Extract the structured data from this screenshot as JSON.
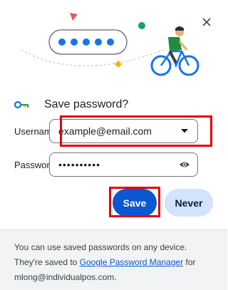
{
  "dialog": {
    "title": "Save password?",
    "close_label": "Close"
  },
  "form": {
    "username_label": "Username",
    "username_value": "example@email.com",
    "password_label": "Password",
    "password_value": "••••••••••"
  },
  "buttons": {
    "save_label": "Save",
    "never_label": "Never"
  },
  "footer": {
    "text_before_link": "You can use saved passwords on any device. They're saved to ",
    "link_text": "Google Password Manager",
    "text_after_link": " for",
    "account": "mlong@individualpos.com."
  },
  "icons": {
    "close": "close-icon",
    "key": "key-icon",
    "dropdown": "dropdown-arrow-icon",
    "eye": "eye-icon"
  },
  "colors": {
    "primary": "#0b57d0",
    "secondary": "#d3e3fd",
    "highlight": "#e3000f",
    "footer_bg": "#f1f3f4"
  }
}
